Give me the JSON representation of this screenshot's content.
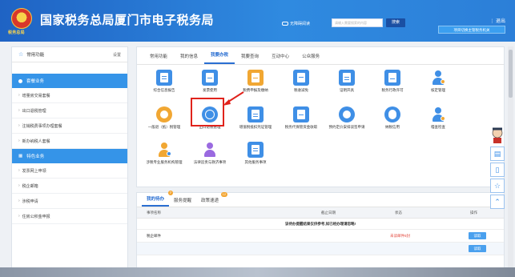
{
  "header": {
    "emblem_text": "税务总局",
    "site_title": "国家税务总局厦门市电子税务局",
    "access_label": "无障碍阅读",
    "search_placeholder": "请输入需要搜索的内容",
    "search_button": "搜索",
    "logout": "退出",
    "switch_label": "项目切换主管税务机关"
  },
  "sidebar": {
    "common_label": "常用功能",
    "setting_label": "设置",
    "section1_title": "套餐业务",
    "section1_items": [
      "增量房交易套餐",
      "出口退税管理",
      "注销税费事项办理套餐",
      "新办纳税人套餐"
    ],
    "section2_title": "特色业务",
    "section2_items": [
      "发票网上申领",
      "税企邮箱",
      "涉税申请",
      "住房公积金申报"
    ]
  },
  "main_tabs": [
    "常用功能",
    "我的信息",
    "我要办税",
    "我要查询",
    "互动中心",
    "公众服务"
  ],
  "active_tab": "我要办税",
  "icons": [
    {
      "label": "综合信息报告",
      "icon": "document-icon",
      "color": "blue"
    },
    {
      "label": "发票使用",
      "icon": "invoice-check-icon",
      "color": "blue"
    },
    {
      "label": "税费申报及缴纳",
      "icon": "tax-payment-icon",
      "color": "gold"
    },
    {
      "label": "税收减免",
      "icon": "tax-reduction-icon",
      "color": "blue"
    },
    {
      "label": "证明开具",
      "icon": "certificate-icon",
      "color": "blue"
    },
    {
      "label": "税务行政许可",
      "icon": "license-icon",
      "color": "blue"
    },
    {
      "label": "核定管理",
      "icon": "approval-person-icon",
      "color": "blue"
    },
    {
      "label": "一般退（抵）税管理",
      "icon": "refund-icon",
      "color": "gold"
    },
    {
      "label": "出口退税管理",
      "icon": "globe-icon",
      "color": "blue"
    },
    {
      "label": "增值税抵扣凭证管理",
      "icon": "voucher-icon",
      "color": "blue"
    },
    {
      "label": "税务代保管资金收取",
      "icon": "custody-fund-icon",
      "color": "blue"
    },
    {
      "label": "预约定价安排谈签申请",
      "icon": "pricing-arrangement-icon",
      "color": "blue"
    },
    {
      "label": "纳税信用",
      "icon": "credit-icon",
      "color": "blue"
    },
    {
      "label": "稽查检查",
      "icon": "inspection-person-icon",
      "color": "blue"
    },
    {
      "label": "涉税专业服务机构管理",
      "icon": "agency-person-icon",
      "color": "gold"
    },
    {
      "label": "法律追责与救济事项",
      "icon": "law-icon",
      "color": "purple"
    },
    {
      "label": "其他服务事项",
      "icon": "other-services-icon",
      "color": "blue"
    }
  ],
  "lower": {
    "tabs": [
      "我的待办",
      "服务提醒",
      "政策速递"
    ],
    "badges": [
      "7",
      "",
      "12"
    ],
    "columns": [
      "事项名称",
      "截止日期",
      "状态",
      "操作"
    ],
    "notice": "该待办提醒结果仅供参考,如已经办理请忽略!",
    "row1": {
      "name": "税企邮件",
      "status": "未读邮件5封",
      "action": "读取"
    },
    "row2": {
      "action": "读取"
    }
  },
  "colors": {
    "accent": "#2a6fd2",
    "header": "#2f8ae0",
    "highlight": "#e0231c"
  }
}
